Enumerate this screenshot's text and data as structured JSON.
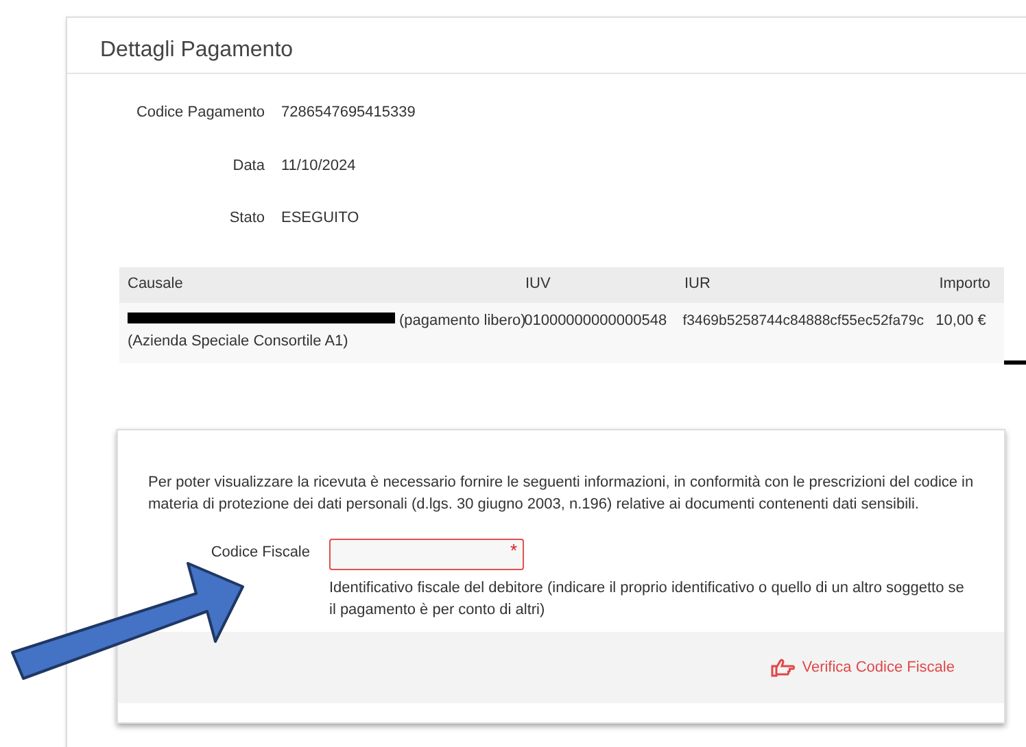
{
  "title": "Dettagli Pagamento",
  "fields": [
    {
      "label": "Codice Pagamento",
      "value": "7286547695415339"
    },
    {
      "label": "Data",
      "value": "11/10/2024"
    },
    {
      "label": "Stato",
      "value": "ESEGUITO"
    }
  ],
  "table": {
    "columns": [
      "Causale",
      "IUV",
      "IUR",
      "Importo"
    ],
    "rows": [
      {
        "causale": "(pagamento libero)",
        "ente": "(Azienda Speciale Consortile A1)",
        "iuv": "01000000000000548",
        "iur": "f3469b5258744c84888cf55ec52fa79c",
        "importo": "10,00 €"
      }
    ]
  },
  "verify": {
    "info": "Per poter visualizzare la ricevuta è necessario fornire le seguenti informazioni, in conformità con le prescrizioni del codice in materia di protezione dei dati personali (d.lgs. 30 giugno 2003, n.196) relative ai documenti contenenti dati sensibili.",
    "field_label": "Codice Fiscale",
    "required_mark": "*",
    "hint": "Identificativo fiscale del debitore (indicare il proprio identificativo o quello di un altro soggetto se il pagamento è per conto di altri)",
    "button": "Verifica Codice Fiscale"
  }
}
